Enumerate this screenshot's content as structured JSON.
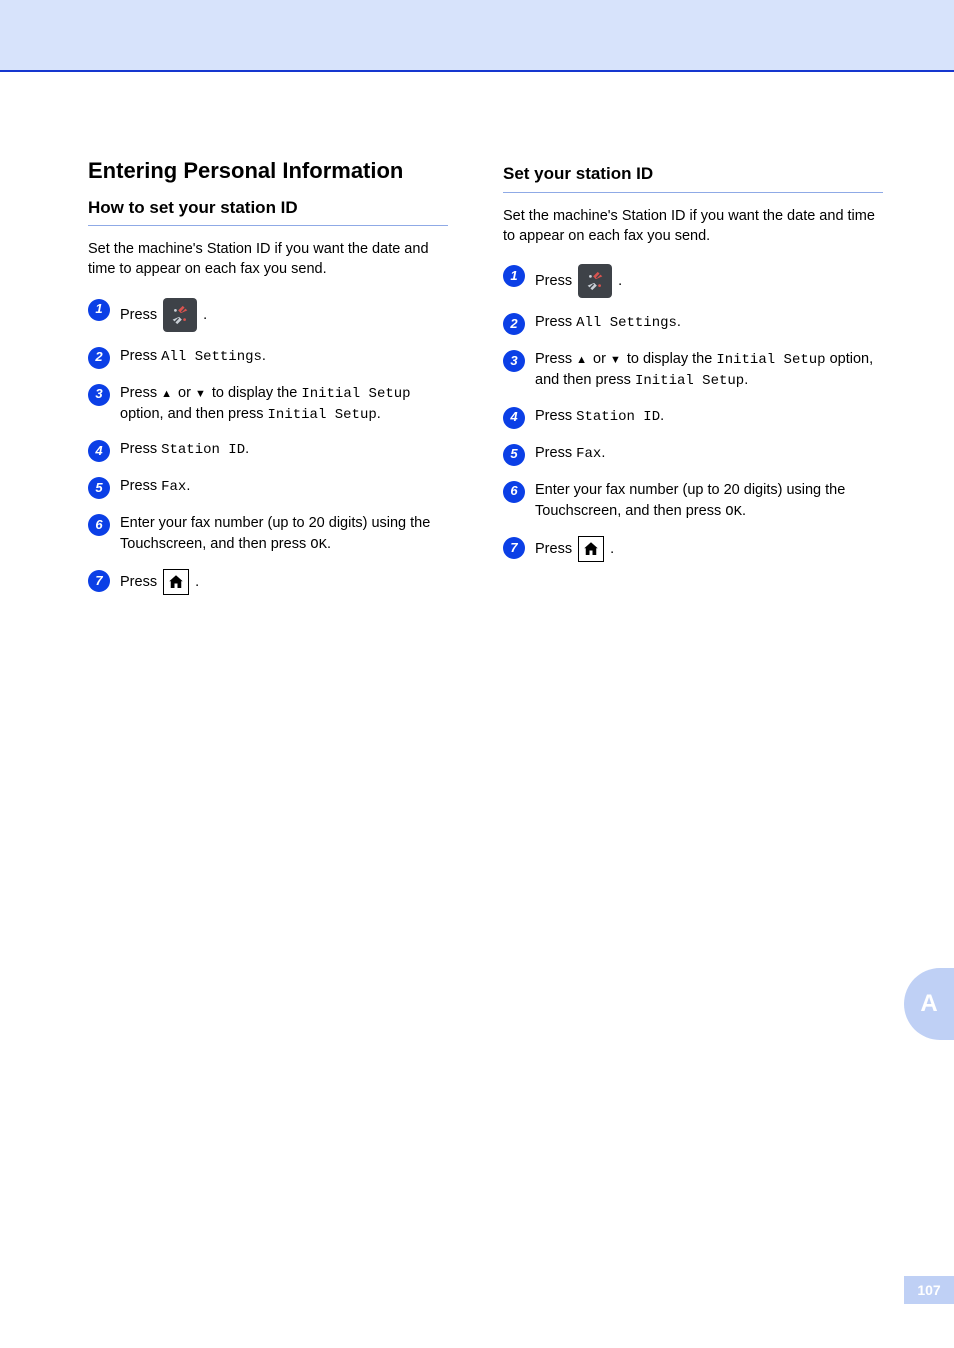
{
  "side_tab": "A",
  "page_number": "107",
  "left": {
    "h1": "Entering Personal Information",
    "h2": "How to set your station ID",
    "intro": "Set the machine's Station ID if you want the date and time to appear on each fax you send.",
    "steps": [
      {
        "n": "1",
        "pre": "Press ",
        "icon": "settings",
        "post": " ."
      },
      {
        "n": "2",
        "text": "Press All Settings.",
        "code": "All Settings"
      },
      {
        "n": "3",
        "pre": "Press ",
        "arrows": true,
        "mid": " or ",
        " post": " to display the ",
        "code": "Initial Setup",
        "post2": " option, and then press ",
        "code2": "Initial Setup",
        "post3": "."
      },
      {
        "n": "4",
        "pre": "Press ",
        "code": "Station ID",
        "post": "."
      },
      {
        "n": "5",
        "pre": "Press ",
        "code": "Fax",
        "post": "."
      },
      {
        "n": "6",
        "text": "Enter your fax number (up to 20 digits) using the Touchscreen, and then press ",
        "code": "OK",
        "post": "."
      },
      {
        "n": "7",
        "pre": "Press ",
        "icon": "home",
        "post": " ."
      }
    ]
  },
  "right": {
    "h2": "Set your station ID",
    "intro": "Set the machine's Station ID if you want the date and time to appear on each fax you send.",
    "steps": [
      {
        "n": "1",
        "pre": "Press ",
        "icon": "settings",
        "post": " ."
      },
      {
        "n": "2",
        "pre": "Press ",
        "code": "All Settings",
        "post": "."
      },
      {
        "n": "3",
        "pre": "Press ",
        "arrows": true,
        "mid": " or ",
        " post": " to display the ",
        "code": "Initial Setup",
        "post2": " option, and then press ",
        "code2": "Initial Setup",
        "post3": "."
      },
      {
        "n": "4",
        "pre": "Press ",
        "code": "Station ID",
        "post": "."
      },
      {
        "n": "5",
        "pre": "Press ",
        "code": "Fax",
        "post": "."
      },
      {
        "n": "6",
        "text": "Enter your fax number (up to 20 digits) using the Touchscreen, and then press ",
        "code": "OK",
        "post": "."
      },
      {
        "n": "7",
        "pre": "Press ",
        "icon": "home",
        "post": " ."
      }
    ]
  },
  "icons": {
    "settings": "settings-icon",
    "home": "home-icon"
  }
}
